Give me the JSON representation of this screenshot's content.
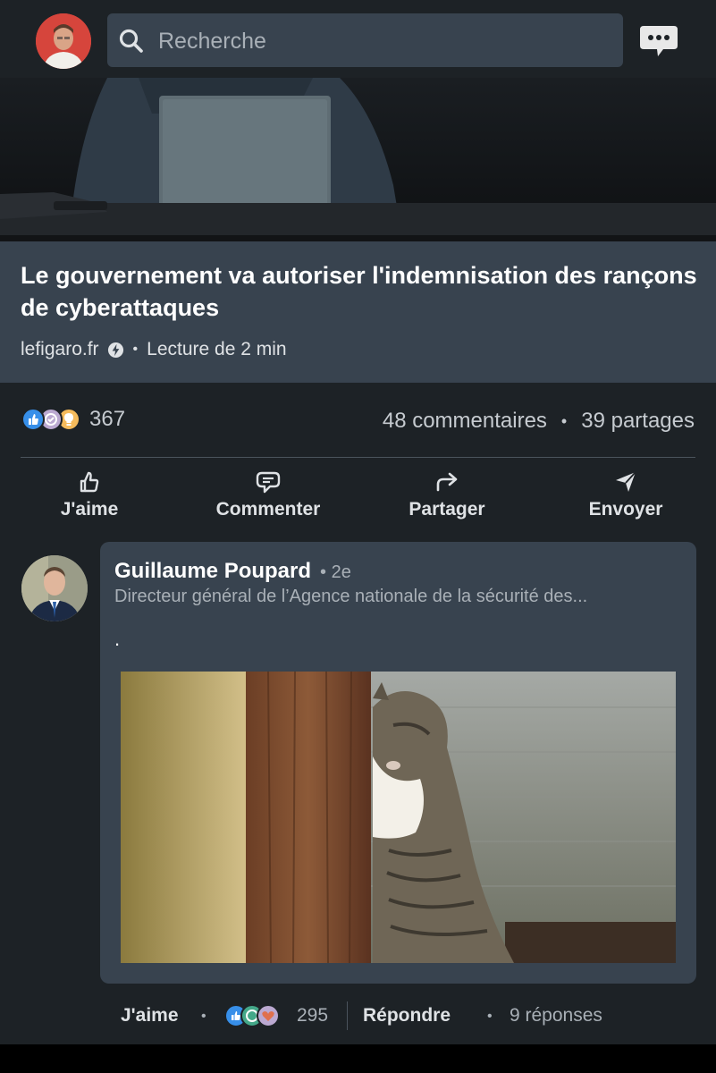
{
  "search": {
    "placeholder": "Recherche"
  },
  "article": {
    "title": "Le gouvernement va autoriser l'indemnisation des rançons de cyberattaques",
    "source": "lefigaro.fr",
    "read_time": "Lecture de 2 min"
  },
  "stats": {
    "reactions": "367",
    "comments": "48 commentaires",
    "shares": "39 partages",
    "separator": "•"
  },
  "actions": {
    "like": "J'aime",
    "comment": "Commenter",
    "share": "Partager",
    "send": "Envoyer"
  },
  "comment": {
    "author": "Guillaume Poupard",
    "degree": "• 2e",
    "headline": "Directeur général de l’Agence nationale de la sécurité des...",
    "text": ".",
    "like_label": "J'aime",
    "reaction_count": "295",
    "reply_label": "Répondre",
    "replies": "9 réponses",
    "separator": "•"
  },
  "colors": {
    "background": "#1d2226",
    "card": "#38434f",
    "like_blue": "#378fe9",
    "celebrate_green": "#44712e",
    "insight_yellow": "#f5bb5c",
    "love_red": "#df704d"
  }
}
